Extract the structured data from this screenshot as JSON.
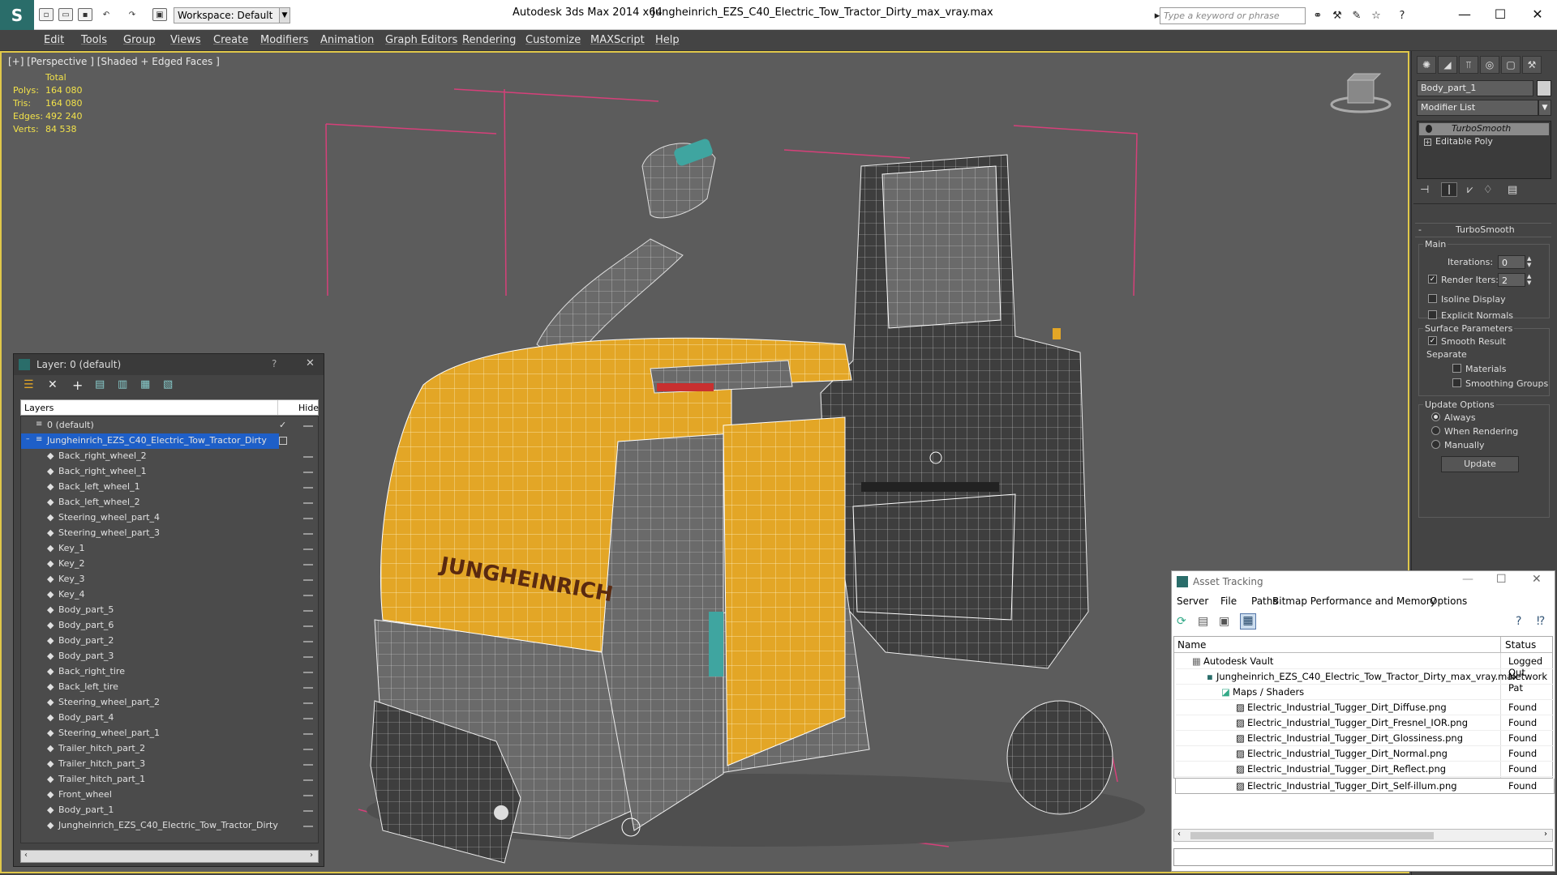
{
  "titlebar": {
    "workspace": "Workspace: Default",
    "app_name": "Autodesk 3ds Max  2014 x64",
    "file_name": "Jungheinrich_EZS_C40_Electric_Tow_Tractor_Dirty_max_vray.max",
    "search_placeholder": "Type a keyword or phrase"
  },
  "menu": [
    "Edit",
    "Tools",
    "Group",
    "Views",
    "Create",
    "Modifiers",
    "Animation",
    "Graph Editors",
    "Rendering",
    "Customize",
    "MAXScript",
    "Help"
  ],
  "viewport": {
    "label": "[+] [Perspective ] [Shaded + Edged Faces ]",
    "stats_header": "Total",
    "stats": [
      {
        "label": "Polys:",
        "value": "164 080"
      },
      {
        "label": "Tris:",
        "value": "164 080"
      },
      {
        "label": "Edges:",
        "value": "492 240"
      },
      {
        "label": "Verts:",
        "value": "84 538"
      }
    ],
    "brand_text": "JUNGHEINRICH",
    "colors": {
      "body_yellow": "#e3a626",
      "wire": "#ffffff",
      "bounds": "#d6407a",
      "bg": "#5c5c5c"
    }
  },
  "command_panel": {
    "object_name": "Body_part_1",
    "modifier_list": "Modifier List",
    "stack": [
      "TurboSmooth",
      "Editable Poly"
    ],
    "rollout_title": "TurboSmooth",
    "main_label": "Main",
    "iterations_label": "Iterations:",
    "iterations_value": "0",
    "render_iters_label": "Render Iters:",
    "render_iters_value": "2",
    "isoline": "Isoline Display",
    "explicit_normals": "Explicit Normals",
    "surface_params": "Surface Parameters",
    "smooth_result": "Smooth Result",
    "separate": "Separate",
    "materials": "Materials",
    "smoothing_groups": "Smoothing Groups",
    "update_options": "Update Options",
    "always": "Always",
    "when_rendering": "When Rendering",
    "manually": "Manually",
    "update_button": "Update"
  },
  "layer_explorer": {
    "title": "Layer: 0 (default)",
    "help": "?",
    "col_layers": "Layers",
    "col_hide": "Hide",
    "rows": [
      "0 (default)",
      "Jungheinrich_EZS_C40_Electric_Tow_Tractor_Dirty",
      "Back_right_wheel_2",
      "Back_right_wheel_1",
      "Back_left_wheel_1",
      "Back_left_wheel_2",
      "Steering_wheel_part_4",
      "Steering_wheel_part_3",
      "Key_1",
      "Key_2",
      "Key_3",
      "Key_4",
      "Body_part_5",
      "Body_part_6",
      "Body_part_2",
      "Body_part_3",
      "Back_right_tire",
      "Back_left_tire",
      "Steering_wheel_part_2",
      "Body_part_4",
      "Steering_wheel_part_1",
      "Trailer_hitch_part_2",
      "Trailer_hitch_part_3",
      "Trailer_hitch_part_1",
      "Front_wheel",
      "Body_part_1",
      "Jungheinrich_EZS_C40_Electric_Tow_Tractor_Dirty"
    ]
  },
  "asset_tracking": {
    "title": "Asset Tracking",
    "menu": [
      "Server",
      "File",
      "Paths",
      "Bitmap Performance and Memory",
      "Options"
    ],
    "col_name": "Name",
    "col_status": "Status",
    "rows": [
      {
        "name": "Autodesk Vault",
        "status": "Logged Out"
      },
      {
        "name": "Jungheinrich_EZS_C40_Electric_Tow_Tractor_Dirty_max_vray.max",
        "status": "Network Pat"
      },
      {
        "name": "Maps / Shaders",
        "status": ""
      },
      {
        "name": "Electric_Industrial_Tugger_Dirt_Diffuse.png",
        "status": "Found"
      },
      {
        "name": "Electric_Industrial_Tugger_Dirt_Fresnel_IOR.png",
        "status": "Found"
      },
      {
        "name": "Electric_Industrial_Tugger_Dirt_Glossiness.png",
        "status": "Found"
      },
      {
        "name": "Electric_Industrial_Tugger_Dirt_Normal.png",
        "status": "Found"
      },
      {
        "name": "Electric_Industrial_Tugger_Dirt_Reflect.png",
        "status": "Found"
      },
      {
        "name": "Electric_Industrial_Tugger_Dirt_Self-illum.png",
        "status": "Found"
      }
    ]
  }
}
